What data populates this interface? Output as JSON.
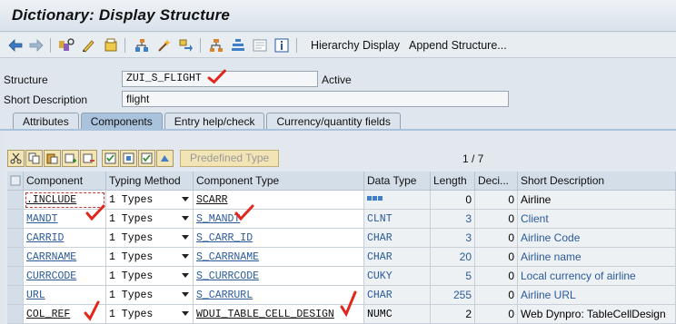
{
  "window": {
    "title": "Dictionary: Display Structure"
  },
  "toolbar": {
    "icons": [
      "back-arrow-icon",
      "forward-arrow-icon",
      "other-object-icon",
      "display-change-icon",
      "activate-icon",
      "where-used-icon",
      "test-icon",
      "navigate-icon",
      "hierarchy-icon",
      "tree-icon",
      "documentation-icon",
      "info-icon"
    ],
    "hierarchy_display": "Hierarchy Display",
    "append_structure": "Append Structure..."
  },
  "header": {
    "structure_label": "Structure",
    "structure_value": "ZUI_S_FLIGHT",
    "status": "Active",
    "short_desc_label": "Short Description",
    "short_desc_value": "flight"
  },
  "tabs": [
    "Attributes",
    "Components",
    "Entry help/check",
    "Currency/quantity fields"
  ],
  "active_tab": "Components",
  "table_toolbar": {
    "predefined_type": "Predefined Type",
    "pager": "1 / 7"
  },
  "columns": [
    "Component",
    "Typing Method",
    "Component Type",
    "Data Type",
    "Length",
    "Deci...",
    "Short Description"
  ],
  "rows": [
    {
      "component": ".INCLUDE",
      "typing": "1 Types",
      "ctype": "SCARR",
      "dtype": "",
      "length": "0",
      "dec": "0",
      "desc": "Airline"
    },
    {
      "component": "MANDT",
      "typing": "1 Types",
      "ctype": "S_MANDT",
      "dtype": "CLNT",
      "length": "3",
      "dec": "0",
      "desc": "Client"
    },
    {
      "component": "CARRID",
      "typing": "1 Types",
      "ctype": "S_CARR_ID",
      "dtype": "CHAR",
      "length": "3",
      "dec": "0",
      "desc": "Airline Code"
    },
    {
      "component": "CARRNAME",
      "typing": "1 Types",
      "ctype": "S_CARRNAME",
      "dtype": "CHAR",
      "length": "20",
      "dec": "0",
      "desc": "Airline name"
    },
    {
      "component": "CURRCODE",
      "typing": "1 Types",
      "ctype": "S_CURRCODE",
      "dtype": "CUKY",
      "length": "5",
      "dec": "0",
      "desc": "Local currency of airline"
    },
    {
      "component": "URL",
      "typing": "1 Types",
      "ctype": "S_CARRURL",
      "dtype": "CHAR",
      "length": "255",
      "dec": "0",
      "desc": "Airline URL"
    },
    {
      "component": "COL_REF",
      "typing": "1 Types",
      "ctype": "WDUI_TABLE_CELL_DESIGN",
      "dtype": "NUMC",
      "length": "2",
      "dec": "0",
      "desc": "Web Dynpro: TableCellDesign"
    }
  ],
  "colors": {
    "accent": "#a9c3dc",
    "annotation": "#e0261d",
    "link": "#2a5a9a"
  }
}
